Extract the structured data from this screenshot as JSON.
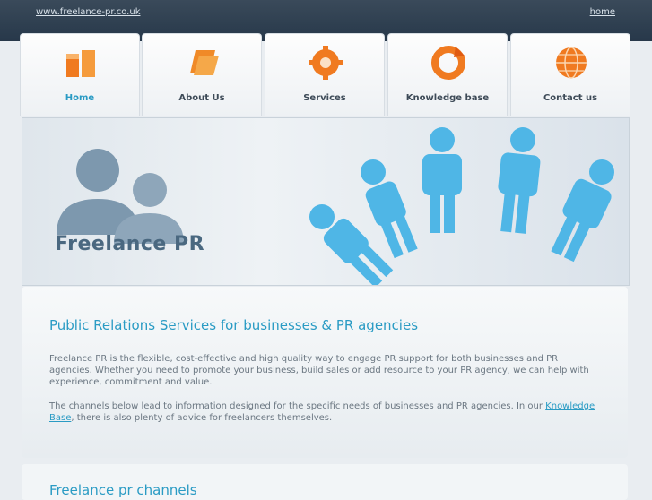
{
  "topbar": {
    "site_url": "www.freelance-pr.co.uk",
    "home_link": "home"
  },
  "nav": {
    "items": [
      {
        "label": "Home",
        "icon": "home-icon",
        "active": true
      },
      {
        "label": "About Us",
        "icon": "folder-icon",
        "active": false
      },
      {
        "label": "Services",
        "icon": "gear-icon",
        "active": false
      },
      {
        "label": "Knowledge base",
        "icon": "refresh-icon",
        "active": false
      },
      {
        "label": "Contact us",
        "icon": "globe-icon",
        "active": false
      }
    ]
  },
  "banner": {
    "logo_text": "Freelance PR"
  },
  "content": {
    "heading": "Public Relations Services for businesses & PR agencies",
    "paragraph1": "Freelance PR is the flexible, cost-effective and high quality way to engage PR support for both businesses and PR agencies. Whether you need to promote your business, build sales or add resource to your PR agency, we can help with experience, commitment and value.",
    "paragraph2_before": "The channels below lead to information designed for the specific needs of businesses and PR agencies. In our ",
    "paragraph2_link": "Knowledge Base",
    "paragraph2_after": ", there is also plenty of advice for freelancers themselves."
  },
  "next_panel": {
    "heading": "Freelance pr channels"
  },
  "colors": {
    "accent": "#2a9bc4",
    "topbar": "#2b3b4c",
    "icon_orange": "#f07a20"
  }
}
